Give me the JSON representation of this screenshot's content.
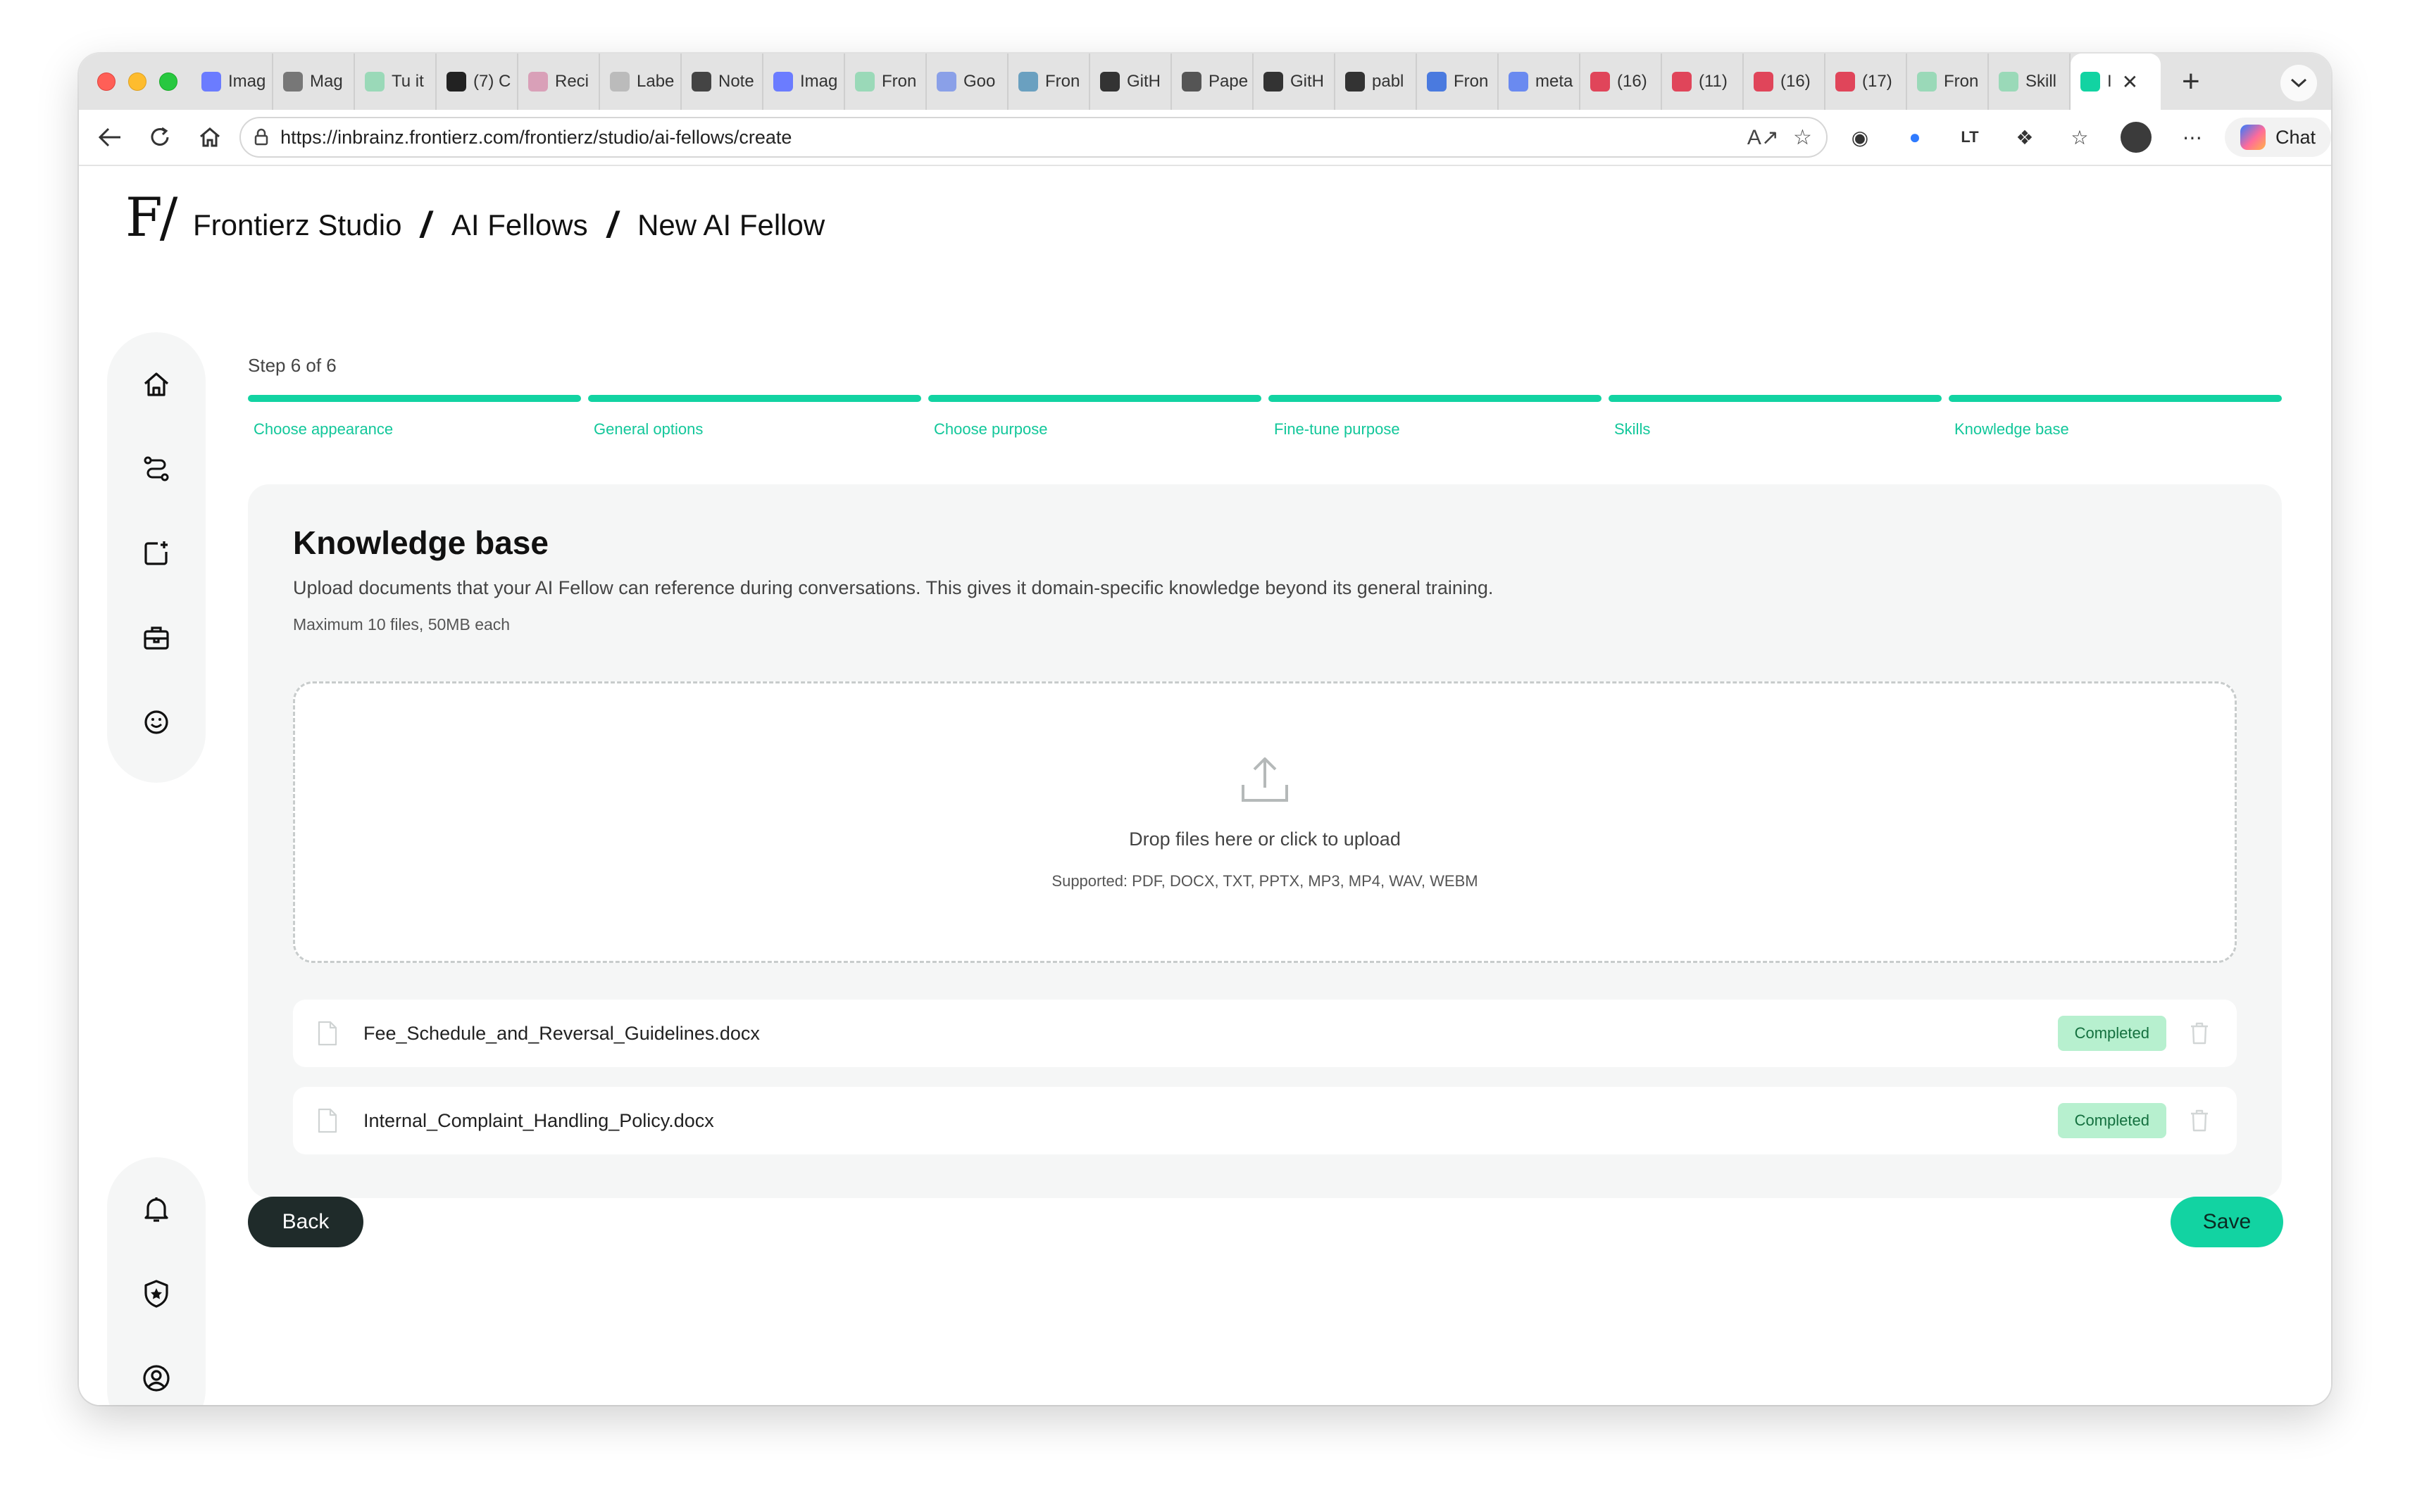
{
  "browser": {
    "tabs": [
      {
        "label": "Imag",
        "icon": "doc-icon",
        "color": "#6b7cff"
      },
      {
        "label": "Mag",
        "icon": "triangle-icon",
        "color": "#777777"
      },
      {
        "label": "Tu it",
        "icon": "fz-icon",
        "color": "#9ad9b8"
      },
      {
        "label": "(7) C",
        "icon": "x-icon",
        "color": "#222222"
      },
      {
        "label": "Reci",
        "icon": "gmail-icon",
        "color": "#d9a0b8"
      },
      {
        "label": "Labe",
        "icon": "sparkle-icon",
        "color": "#bbbbbb"
      },
      {
        "label": "Note",
        "icon": "circle-icon",
        "color": "#444444"
      },
      {
        "label": "Imag",
        "icon": "doc-icon",
        "color": "#6b7cff"
      },
      {
        "label": "Fron",
        "icon": "fz-icon",
        "color": "#9ad9b8"
      },
      {
        "label": "Goo",
        "icon": "gemini-icon",
        "color": "#8aa0e8"
      },
      {
        "label": "Fron",
        "icon": "person-icon",
        "color": "#6aa0c0"
      },
      {
        "label": "GitH",
        "icon": "github-icon",
        "color": "#333333"
      },
      {
        "label": "Pape",
        "icon": "paper-icon",
        "color": "#555555"
      },
      {
        "label": "GitH",
        "icon": "github-icon",
        "color": "#333333"
      },
      {
        "label": "pabl",
        "icon": "github-icon",
        "color": "#333333"
      },
      {
        "label": "Fron",
        "icon": "cross-icon",
        "color": "#4a7adf"
      },
      {
        "label": "meta",
        "icon": "meta-icon",
        "color": "#6a8af0"
      },
      {
        "label": "(16)",
        "icon": "youtube-icon",
        "color": "#e0455a"
      },
      {
        "label": "(11)",
        "icon": "youtube-icon",
        "color": "#e0455a"
      },
      {
        "label": "(16)",
        "icon": "youtube-icon",
        "color": "#e0455a"
      },
      {
        "label": "(17)",
        "icon": "youtube-icon",
        "color": "#e0455a"
      },
      {
        "label": "Fron",
        "icon": "fz-icon",
        "color": "#9ad9b8"
      },
      {
        "label": "Skill",
        "icon": "fz-icon",
        "color": "#9ad9b8"
      }
    ],
    "active_tab": {
      "label": "I",
      "icon": "fz-icon",
      "color": "#12d3a2"
    },
    "url": "https://inbrainz.frontierz.com/frontierz/studio/ai-fellows/create",
    "chat_label": "Chat"
  },
  "header": {
    "logo": "F/",
    "breadcrumb": [
      "Frontierz Studio",
      "AI Fellows",
      "New AI Fellow"
    ]
  },
  "sidebar": {
    "top": [
      "home-icon",
      "route-icon",
      "add-post-icon",
      "briefcase-icon",
      "smiley-icon"
    ],
    "bottom": [
      "bell-icon",
      "shield-star-icon",
      "user-circle-icon"
    ]
  },
  "wizard": {
    "step_label": "Step 6 of 6",
    "steps": [
      "Choose appearance",
      "General options",
      "Choose purpose",
      "Fine-tune purpose",
      "Skills",
      "Knowledge base"
    ],
    "accent": "#12d3a2"
  },
  "knowledge": {
    "title": "Knowledge base",
    "description": "Upload documents that your AI Fellow can reference during conversations. This gives it domain-specific knowledge beyond its general training.",
    "limit": "Maximum 10 files, 50MB each",
    "drop_text": "Drop files here or click to upload",
    "supported": "Supported: PDF, DOCX, TXT, PPTX, MP3, MP4, WAV, WEBM",
    "files": [
      {
        "name": "Fee_Schedule_and_Reversal_Guidelines.docx",
        "status": "Completed"
      },
      {
        "name": "Internal_Complaint_Handling_Policy.docx",
        "status": "Completed"
      }
    ]
  },
  "actions": {
    "back": "Back",
    "save": "Save"
  }
}
